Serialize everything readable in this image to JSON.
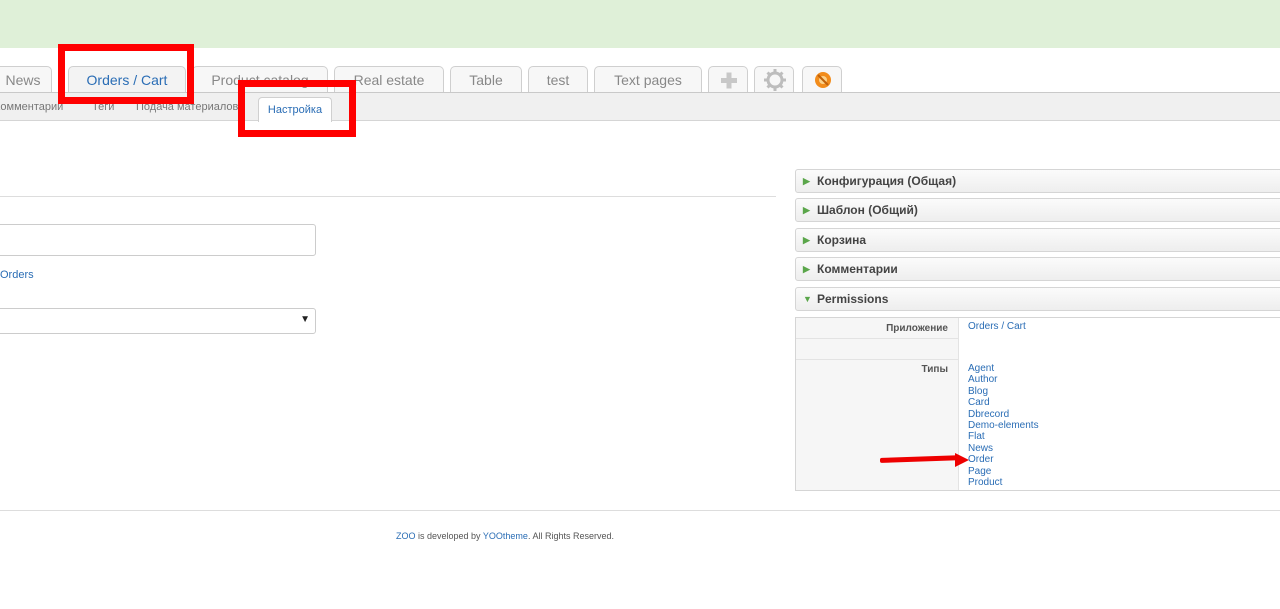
{
  "main_tabs": [
    "News",
    "Orders / Cart",
    "Product catalog",
    "Real estate",
    "Table",
    "test",
    "Text pages"
  ],
  "tool_tabs": {
    "add": "plus-icon",
    "settings": "gear-icon",
    "install": "puzzle-icon"
  },
  "sub_nav": [
    "Комментарии",
    "Теги",
    "Подача материалов",
    "Настройка"
  ],
  "form": {
    "link_text": "Orders",
    "select_value": ""
  },
  "panels": [
    "Конфигурация (Общая)",
    "Шаблон (Общий)",
    "Корзина",
    "Комментарии",
    "Permissions"
  ],
  "permissions": {
    "app_label": "Приложение",
    "app_value": "Orders / Cart",
    "types_label": "Типы",
    "types": [
      "Agent",
      "Author",
      "Blog",
      "Card",
      "Dbrecord",
      "Demo-elements",
      "Flat",
      "News",
      "Order",
      "Page",
      "Product"
    ]
  },
  "footer": {
    "zoo": "ZOO",
    "developed": " is developed by ",
    "yoo": "YOOtheme",
    "rights": ". All Rights Reserved."
  },
  "colors": {
    "topbar": "#dff0d8",
    "link": "#2a6db5",
    "highlight": "#ff0000",
    "arrow": "#e00000"
  }
}
